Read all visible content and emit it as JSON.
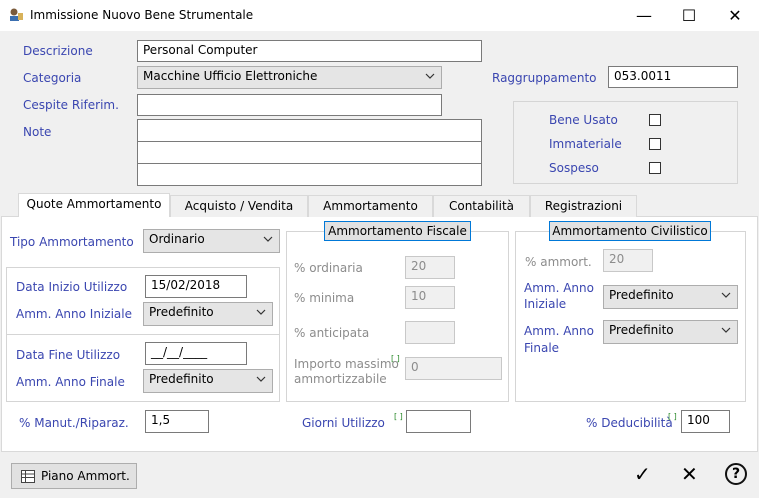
{
  "window": {
    "title": "Immissione Nuovo Bene Strumentale",
    "minimize_glyph": "—",
    "maximize_glyph": "☐",
    "close_glyph": "✕"
  },
  "header": {
    "descrizione_label": "Descrizione",
    "descrizione_value": "Personal Computer",
    "categoria_label": "Categoria",
    "categoria_value": "Macchine Ufficio Elettroniche",
    "cespite_label": "Cespite Riferim.",
    "cespite_value": "",
    "note_label": "Note",
    "raggruppamento_label": "Raggruppamento",
    "raggruppamento_value": "053.0011",
    "flags": {
      "bene_usato": "Bene Usato",
      "immateriale": "Immateriale",
      "sospeso": "Sospeso"
    }
  },
  "tabs": [
    {
      "label": "Quote Ammortamento"
    },
    {
      "label": "Acquisto / Vendita"
    },
    {
      "label": "Ammortamento"
    },
    {
      "label": "Contabilità"
    },
    {
      "label": "Registrazioni"
    }
  ],
  "quote": {
    "tipo_label": "Tipo Ammortamento",
    "tipo_value": "Ordinario",
    "data_inizio_label": "Data Inizio Utilizzo",
    "data_inizio_value": "15/02/2018",
    "amm_iniziale_label": "Amm. Anno Iniziale",
    "amm_iniziale_value": "Predefinito",
    "data_fine_label": "Data Fine Utilizzo",
    "data_fine_value": "__/__/____",
    "amm_finale_label": "Amm. Anno Finale",
    "amm_finale_value": "Predefinito",
    "fiscale": {
      "header": "Ammortamento Fiscale",
      "ordinaria_label": "% ordinaria",
      "ordinaria_value": "20",
      "minima_label": "% minima",
      "minima_value": "10",
      "anticipata_label": "% anticipata",
      "anticipata_value": "",
      "importo_label_1": "Importo massimo",
      "importo_label_2": "ammortizzabile",
      "importo_value": "0"
    },
    "civilistico": {
      "header": "Ammortamento Civilistico",
      "ammort_label": "% ammort.",
      "ammort_value": "20",
      "iniziale_label_1": "Amm. Anno",
      "iniziale_label_2": "Iniziale",
      "iniziale_value": "Predefinito",
      "finale_label_1": "Amm. Anno",
      "finale_label_2": "Finale",
      "finale_value": "Predefinito"
    },
    "manut_label": "% Manut./Riparaz.",
    "manut_value": "1,5",
    "giorni_label": "Giorni Utilizzo",
    "giorni_value": "",
    "deducibilita_label": "% Deducibilità",
    "deducibilita_value": "100"
  },
  "footer": {
    "piano_label": "Piano Ammort.",
    "ok_glyph": "✓",
    "cancel_glyph": "✕",
    "help_glyph": "?"
  }
}
